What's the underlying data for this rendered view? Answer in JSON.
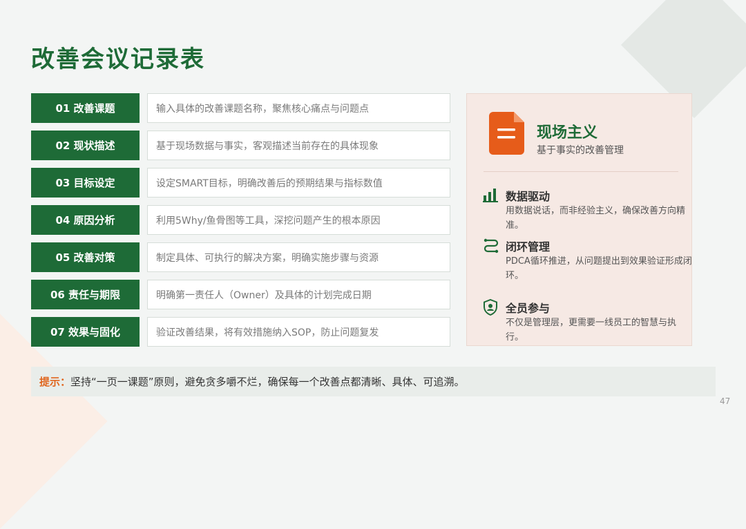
{
  "title": "改善会议记录表",
  "rows": [
    {
      "label": "01 改善课题",
      "placeholder": "输入具体的改善课题名称，聚焦核心痛点与问题点"
    },
    {
      "label": "02 现状描述",
      "placeholder": "基于现场数据与事实，客观描述当前存在的具体现象"
    },
    {
      "label": "03 目标设定",
      "placeholder": "设定SMART目标，明确改善后的预期结果与指标数值"
    },
    {
      "label": "04 原因分析",
      "placeholder": "利用5Why/鱼骨图等工具，深挖问题产生的根本原因"
    },
    {
      "label": "05 改善对策",
      "placeholder": "制定具体、可执行的解决方案，明确实施步骤与资源"
    },
    {
      "label": "06 责任与期限",
      "placeholder": "明确第一责任人（Owner）及具体的计划完成日期"
    },
    {
      "label": "07 效果与固化",
      "placeholder": "验证改善结果，将有效措施纳入SOP，防止问题复发"
    }
  ],
  "panel": {
    "title": "现场主义",
    "subtitle": "基于事实的改善管理",
    "icon": "document-icon",
    "features": [
      {
        "icon": "bar-chart-icon",
        "title": "数据驱动",
        "desc": "用数据说话，而非经验主义，确保改善方向精准。"
      },
      {
        "icon": "loop-icon",
        "title": "闭环管理",
        "desc": "PDCA循环推进，从问题提出到效果验证形成闭环。"
      },
      {
        "icon": "shield-user-icon",
        "title": "全员参与",
        "desc": "不仅是管理层，更需要一线员工的智慧与执行。"
      }
    ]
  },
  "tip": {
    "label": "提示：",
    "text": "坚持“一页一课题”原则，避免贪多嚼不烂，确保每一个改善点都清晰、具体、可追溯。"
  },
  "page_number": "47",
  "colors": {
    "primary": "#1e6b37",
    "accent": "#e0661f",
    "panel_bg": "#f6e9e4"
  }
}
